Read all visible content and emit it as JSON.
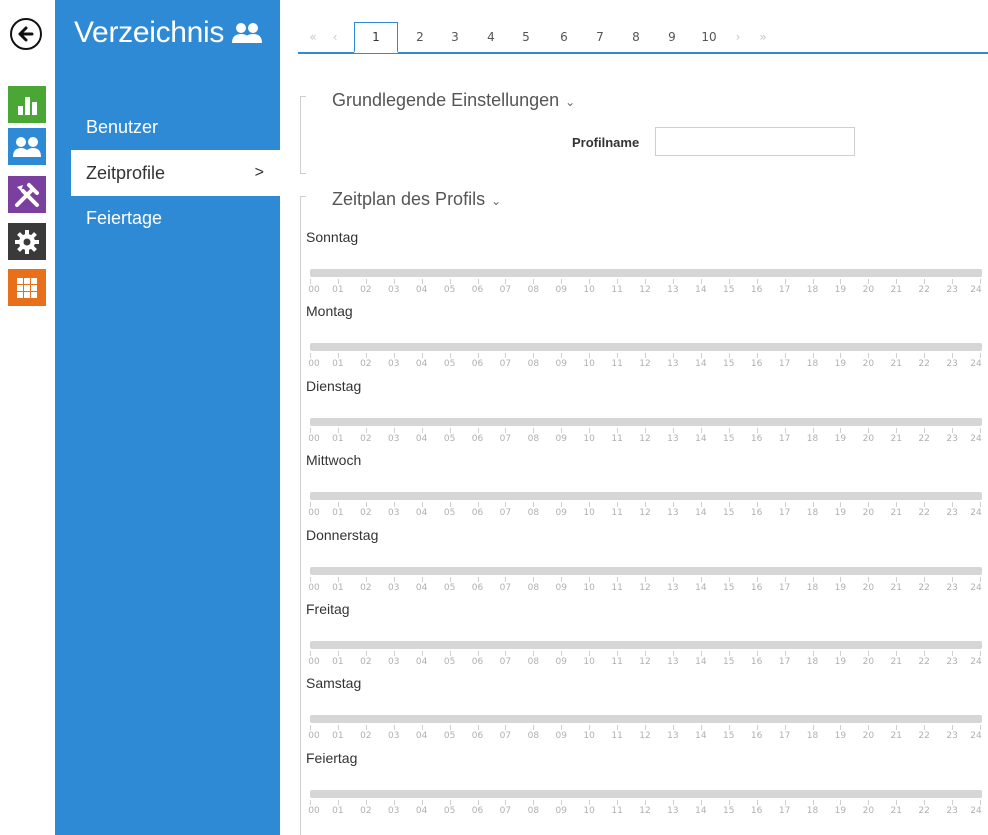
{
  "iconbar": {
    "back_icon": "arrow-left-icon",
    "tiles": [
      {
        "name": "status-icon",
        "color": "#4aa635"
      },
      {
        "name": "directory-icon",
        "color": "#2f8ad6"
      },
      {
        "name": "hardware-icon",
        "color": "#7b3fa0"
      },
      {
        "name": "services-icon",
        "color": "#3a3a3a"
      },
      {
        "name": "system-icon",
        "color": "#e8701a"
      }
    ]
  },
  "sidenav": {
    "title": "Verzeichnis",
    "title_icon": "users-icon",
    "items": [
      {
        "label": "Benutzer",
        "active": false
      },
      {
        "label": "Zeitprofile",
        "active": true,
        "chevron": ">"
      },
      {
        "label": "Feiertage",
        "active": false
      }
    ]
  },
  "tabs": {
    "first": "«",
    "prev": "‹",
    "pages": [
      "1",
      "2",
      "3",
      "4",
      "5",
      "6",
      "7",
      "8",
      "9",
      "10"
    ],
    "active": "1",
    "next": "›",
    "last": "»"
  },
  "basic": {
    "title": "Grundlegende Einstellungen",
    "caret": "⌄",
    "profile_name_label": "Profilname",
    "profile_name_value": ""
  },
  "schedule": {
    "title": "Zeitplan des Profils",
    "caret": "⌄",
    "hours": [
      "00",
      "01",
      "02",
      "03",
      "04",
      "05",
      "06",
      "07",
      "08",
      "09",
      "10",
      "11",
      "12",
      "13",
      "14",
      "15",
      "16",
      "17",
      "18",
      "19",
      "20",
      "21",
      "22",
      "23",
      "24"
    ],
    "days": [
      "Sonntag",
      "Montag",
      "Dienstag",
      "Mittwoch",
      "Donnerstag",
      "Freitag",
      "Samstag",
      "Feiertag"
    ]
  },
  "colors": {
    "accent": "#2f8ad6",
    "bar": "#d6d6d6"
  }
}
